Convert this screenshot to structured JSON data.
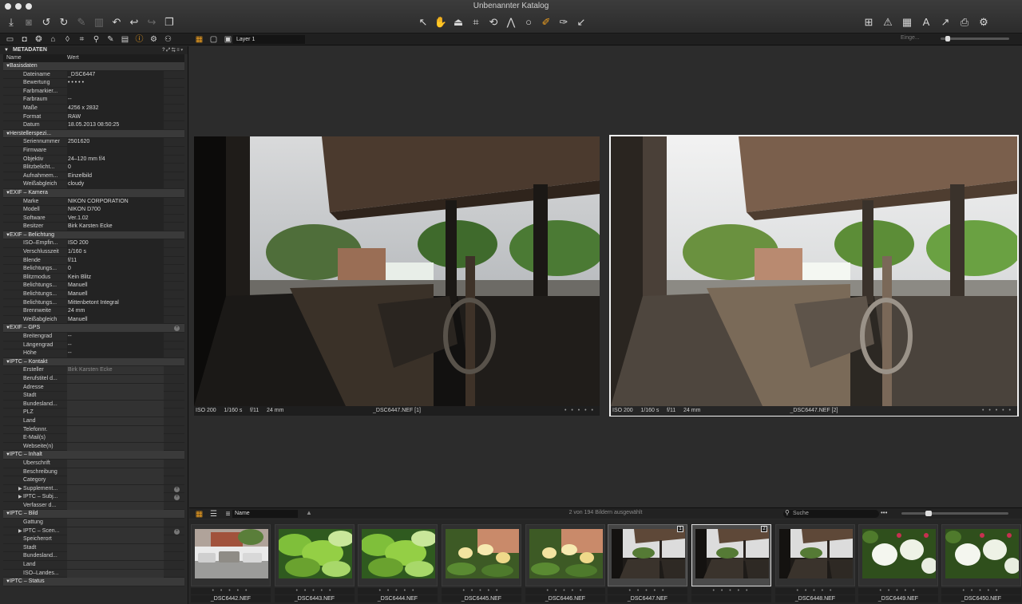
{
  "window": {
    "title": "Unbenannter Katalog"
  },
  "toolbar": {
    "left_icons": [
      "import-icon",
      "camera-icon",
      "rotate-left-icon",
      "rotate-right-icon",
      "edit-icon",
      "trash-icon",
      "reset-icon",
      "undo-icon",
      "redo-icon",
      "copy-icon"
    ],
    "center_icons": [
      "select-cursor-icon",
      "pan-hand-icon",
      "straighten-icon",
      "crop-icon",
      "rotate-icon",
      "keystone-icon",
      "spot-icon",
      "brush-icon",
      "erase-icon",
      "picker-icon"
    ],
    "right_icons": [
      "grid-icon",
      "exposure-warning-icon",
      "grid-overlay-icon",
      "text-icon",
      "proof-icon",
      "print-icon",
      "settings-icon"
    ]
  },
  "tools_row": {
    "layer_select": "Layer 1",
    "zoom_label": "Einge..."
  },
  "panel": {
    "title": "METADATEN",
    "col_name": "Name",
    "col_value": "Wert",
    "rows": [
      {
        "t": "sec",
        "k": "Basisdaten"
      },
      {
        "k": "Dateiname",
        "v": "_DSC6447"
      },
      {
        "k": "Bewertung",
        "v": "•  •  •  •  •"
      },
      {
        "k": "Farbmarkier...",
        "v": ""
      },
      {
        "k": "Farbraum",
        "v": "--"
      },
      {
        "k": "Maße",
        "v": "4256 x 2832"
      },
      {
        "k": "Format",
        "v": "RAW"
      },
      {
        "k": "Datum",
        "v": "18.05.2013 08:50:25"
      },
      {
        "t": "sec",
        "k": "Herstellerspezi..."
      },
      {
        "k": "Seriennummer",
        "v": "2501620"
      },
      {
        "k": "Firmware",
        "v": ""
      },
      {
        "k": "Objektiv",
        "v": "24–120 mm f/4"
      },
      {
        "k": "Blitzbelicht...",
        "v": "0"
      },
      {
        "k": "Aufnahmem...",
        "v": "Einzelbild"
      },
      {
        "k": "Weißabgleich",
        "v": "cloudy"
      },
      {
        "t": "sec",
        "k": "EXIF – Kamera"
      },
      {
        "k": "Marke",
        "v": "NIKON CORPORATION"
      },
      {
        "k": "Modell",
        "v": "NIKON D700"
      },
      {
        "k": "Software",
        "v": "Ver.1.02"
      },
      {
        "k": "Besitzer",
        "v": "Birk Karsten Ecke"
      },
      {
        "t": "sec",
        "k": "EXIF – Belichtung"
      },
      {
        "k": "ISO–Empfin...",
        "v": "ISO 200"
      },
      {
        "k": "Verschlusszeit",
        "v": "1/160 s"
      },
      {
        "k": "Blende",
        "v": "f/11"
      },
      {
        "k": "Belichtungs...",
        "v": "0"
      },
      {
        "k": "Blitzmodus",
        "v": "Kein Blitz"
      },
      {
        "k": "Belichtungs...",
        "v": "Manuell"
      },
      {
        "k": "Belichtungs...",
        "v": "Manuell"
      },
      {
        "k": "Belichtungs...",
        "v": "Mittenbetont Integral"
      },
      {
        "k": "Brennweite",
        "v": "24 mm"
      },
      {
        "k": "Weißabgleich",
        "v": "Manuell"
      },
      {
        "t": "sec",
        "k": "EXIF – GPS",
        "plus": true
      },
      {
        "k": "Breitengrad",
        "v": "--"
      },
      {
        "k": "Längengrad",
        "v": "--"
      },
      {
        "k": "Höhe",
        "v": "--"
      },
      {
        "t": "sec",
        "k": "IPTC – Kontakt"
      },
      {
        "k": "Ersteller",
        "v": "Birk Karsten Ecke",
        "e": true,
        "m": true
      },
      {
        "k": "Berufstitel d...",
        "v": "",
        "e": true
      },
      {
        "k": "Adresse",
        "v": "",
        "e": true
      },
      {
        "k": "Stadt",
        "v": "",
        "e": true
      },
      {
        "k": "Bundesland...",
        "v": "",
        "e": true
      },
      {
        "k": "PLZ",
        "v": "",
        "e": true
      },
      {
        "k": "Land",
        "v": "",
        "e": true
      },
      {
        "k": "Telefonnr.",
        "v": "",
        "e": true
      },
      {
        "k": "E-Mail(s)",
        "v": "",
        "e": true
      },
      {
        "k": "Webseite(n)",
        "v": "",
        "e": true
      },
      {
        "t": "sec",
        "k": "IPTC – Inhalt"
      },
      {
        "k": "Überschrift",
        "v": "",
        "e": true
      },
      {
        "k": "Beschreibung",
        "v": "",
        "e": true
      },
      {
        "k": "Category",
        "v": "",
        "e": true
      },
      {
        "k": "Supplement...",
        "v": "",
        "e": true,
        "sub": true,
        "plus": true
      },
      {
        "k": "IPTC – Subj...",
        "v": "",
        "e": true,
        "sub": true,
        "plus": true
      },
      {
        "k": "Verfasser d...",
        "v": "",
        "e": true
      },
      {
        "t": "sec",
        "k": "IPTC – Bild"
      },
      {
        "k": "Gattung",
        "v": "",
        "e": true
      },
      {
        "k": "IPTC – Scen...",
        "v": "",
        "e": true,
        "sub": true,
        "plus": true
      },
      {
        "k": "Speicherort",
        "v": "",
        "e": true
      },
      {
        "k": "Stadt",
        "v": "",
        "e": true
      },
      {
        "k": "Bundesland...",
        "v": "",
        "e": true
      },
      {
        "k": "Land",
        "v": "",
        "e": true
      },
      {
        "k": "ISO–Landes...",
        "v": "",
        "e": true
      },
      {
        "t": "sec",
        "k": "IPTC – Status"
      }
    ]
  },
  "viewer": {
    "left": {
      "iso": "ISO 200",
      "shutter": "1/160 s",
      "aperture": "f/11",
      "focal": "24 mm",
      "name": "_DSC6447.NEF [1]",
      "rating": "•  •  •  •  •"
    },
    "right": {
      "iso": "ISO 200",
      "shutter": "1/160 s",
      "aperture": "f/11",
      "focal": "24 mm",
      "name": "_DSC6447.NEF [2]",
      "rating": "•  •  •  •  •"
    }
  },
  "filmstrip_bar": {
    "sort": "Name",
    "count": "2 von 194 Bildern ausgewählt",
    "search_placeholder": "Suche"
  },
  "thumbs": [
    {
      "name": "_DSC6442.NEF",
      "kind": "street",
      "rating": "•  •  •  •  •"
    },
    {
      "name": "_DSC6443.NEF",
      "kind": "leaves",
      "rating": "•  •  •  •  •"
    },
    {
      "name": "_DSC6444.NEF",
      "kind": "leaves",
      "rating": "•  •  •  •  •"
    },
    {
      "name": "_DSC6445.NEF",
      "kind": "flowers",
      "rating": "•  •  •  •  •"
    },
    {
      "name": "_DSC6446.NEF",
      "kind": "flowers",
      "rating": "•  •  •  •  •"
    },
    {
      "name": "_DSC6447.NEF",
      "kind": "station",
      "rating": "•  •  •  •  •",
      "badge": "1",
      "group": true
    },
    {
      "name": "",
      "kind": "station",
      "rating": "•  •  •  •  •",
      "badge": "2",
      "group": true,
      "primary": true
    },
    {
      "name": "_DSC6448.NEF",
      "kind": "station",
      "rating": "•  •  •  •  •"
    },
    {
      "name": "_DSC6449.NEF",
      "kind": "white",
      "rating": "•  •  •  •  •"
    },
    {
      "name": "_DSC6450.NEF",
      "kind": "white",
      "rating": "•  •  •  •  •"
    }
  ]
}
